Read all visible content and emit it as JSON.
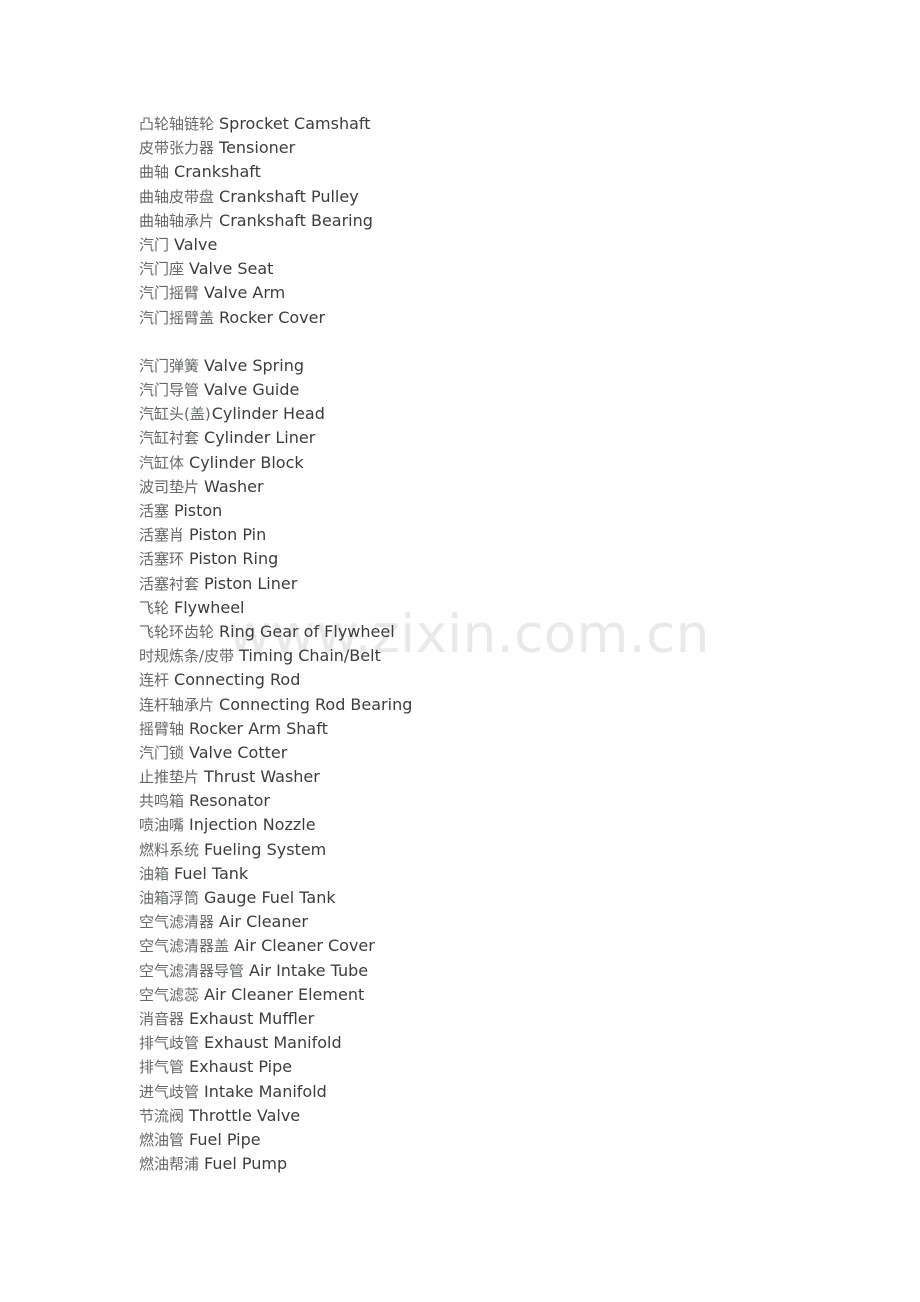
{
  "document": {
    "background_color": "#ffffff",
    "text_color_chinese": "#66686a",
    "text_color_english": "#3b3d3f"
  },
  "watermark": {
    "text": "www.zixin.com.cn",
    "color": "#e9e9e9"
  },
  "terms": [
    {
      "zh": "凸轮轴链轮",
      "en": "Sprocket Camshaft",
      "tight": false
    },
    {
      "zh": "皮带张力器",
      "en": "Tensioner",
      "tight": false
    },
    {
      "zh": "曲轴",
      "en": "Crankshaft",
      "tight": false
    },
    {
      "zh": "曲轴皮带盘",
      "en": "Crankshaft Pulley",
      "tight": false
    },
    {
      "zh": "曲轴轴承片",
      "en": "Crankshaft Bearing",
      "tight": false
    },
    {
      "zh": "汽门",
      "en": "Valve",
      "tight": false
    },
    {
      "zh": "汽门座",
      "en": "Valve Seat",
      "tight": false
    },
    {
      "zh": "汽门摇臂",
      "en": "Valve Arm",
      "tight": false
    },
    {
      "zh": "汽门摇臂盖",
      "en": "Rocker Cover",
      "tight": false
    },
    {
      "zh": "",
      "en": "",
      "tight": false
    },
    {
      "zh": "汽门弹簧",
      "en": "Valve Spring",
      "tight": false
    },
    {
      "zh": "汽门导管",
      "en": "Valve Guide",
      "tight": false
    },
    {
      "zh": "汽缸头(盖)",
      "en": "Cylinder Head",
      "tight": true
    },
    {
      "zh": "汽缸衬套",
      "en": "Cylinder Liner",
      "tight": false
    },
    {
      "zh": "汽缸体",
      "en": "Cylinder Block",
      "tight": false
    },
    {
      "zh": "波司垫片",
      "en": "Washer",
      "tight": false
    },
    {
      "zh": "活塞",
      "en": "Piston",
      "tight": false
    },
    {
      "zh": "活塞肖",
      "en": "Piston Pin",
      "tight": false
    },
    {
      "zh": "活塞环",
      "en": "Piston Ring",
      "tight": false
    },
    {
      "zh": "活塞衬套",
      "en": "Piston Liner",
      "tight": false
    },
    {
      "zh": "飞轮",
      "en": "Flywheel",
      "tight": false
    },
    {
      "zh": "飞轮环齿轮",
      "en": "Ring Gear of Flywheel",
      "tight": false
    },
    {
      "zh": "时规炼条/皮带",
      "en": "Timing Chain/Belt",
      "tight": false
    },
    {
      "zh": "连杆",
      "en": "Connecting Rod",
      "tight": false
    },
    {
      "zh": "连杆轴承片",
      "en": "Connecting Rod Bearing",
      "tight": false
    },
    {
      "zh": "摇臂轴",
      "en": "Rocker Arm Shaft",
      "tight": false
    },
    {
      "zh": "汽门锁",
      "en": "Valve Cotter",
      "tight": false
    },
    {
      "zh": "止推垫片",
      "en": "Thrust Washer",
      "tight": false
    },
    {
      "zh": "共鸣箱",
      "en": "Resonator",
      "tight": false
    },
    {
      "zh": "喷油嘴",
      "en": "Injection Nozzle",
      "tight": false
    },
    {
      "zh": "燃料系统",
      "en": "Fueling System",
      "tight": false
    },
    {
      "zh": "油箱",
      "en": "Fuel Tank",
      "tight": false
    },
    {
      "zh": "油箱浮筒",
      "en": "Gauge Fuel Tank",
      "tight": false
    },
    {
      "zh": "空气滤清器",
      "en": "Air Cleaner",
      "tight": false
    },
    {
      "zh": "空气滤清器盖",
      "en": "Air Cleaner Cover",
      "tight": false
    },
    {
      "zh": "空气滤清器导管",
      "en": "Air Intake Tube",
      "tight": false
    },
    {
      "zh": "空气滤蕊",
      "en": "Air Cleaner Element",
      "tight": false
    },
    {
      "zh": "消音器",
      "en": "Exhaust Muffler",
      "tight": false
    },
    {
      "zh": "排气歧管",
      "en": "Exhaust Manifold",
      "tight": false
    },
    {
      "zh": "排气管",
      "en": "Exhaust Pipe",
      "tight": false
    },
    {
      "zh": "进气歧管",
      "en": "Intake Manifold",
      "tight": false
    },
    {
      "zh": "节流阀",
      "en": "Throttle Valve",
      "tight": false
    },
    {
      "zh": "燃油管",
      "en": "Fuel Pipe",
      "tight": false
    },
    {
      "zh": "燃油帮浦",
      "en": "Fuel Pump",
      "tight": false
    }
  ]
}
